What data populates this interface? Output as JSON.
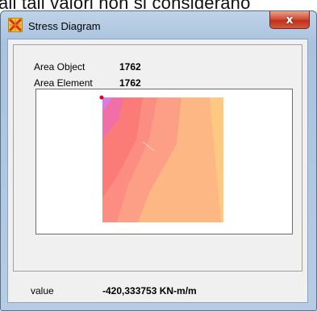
{
  "background": {
    "text": "all tali valori non si considerano"
  },
  "window": {
    "title": "Stress Diagram",
    "close_glyph": "x"
  },
  "info": {
    "area_object_label": "Area Object",
    "area_object_value": "1762",
    "area_element_label": "Area Element",
    "area_element_value": "1762"
  },
  "result": {
    "value_label": "value",
    "value_text": "-420,333753  KN-m/m"
  },
  "colors": {
    "marker": "#e0001b",
    "contour_1": "#d97be6",
    "contour_2": "#f06fa6",
    "contour_3": "#fb7b78",
    "contour_4": "#fc8d82",
    "contour_5": "#fd9f86",
    "contour_6": "#fdb785",
    "contour_7": "#fdc87f"
  }
}
